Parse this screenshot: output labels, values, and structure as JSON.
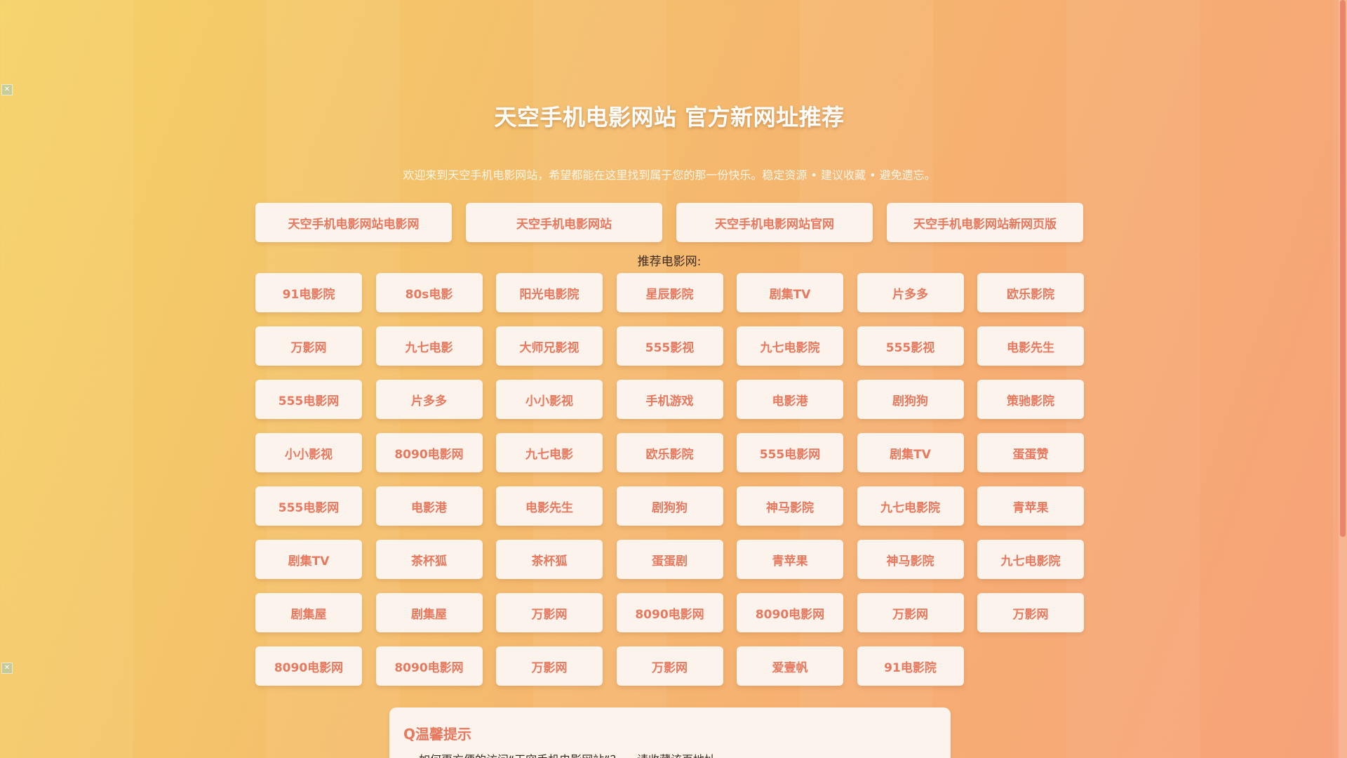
{
  "page": {
    "title": "天空手机电影网站 官方新网址推荐",
    "subtitle": "欢迎来到天空手机电影网站，希望都能在这里找到属于您的那一份快乐。稳定资源 • 建议收藏 • 避免遗忘。"
  },
  "top_links": [
    "天空手机电影网站电影网",
    "天空手机电影网站",
    "天空手机电影网站官网",
    "天空手机电影网站新网页版"
  ],
  "recommend_label": "推荐电影网:",
  "sites": [
    "91电影院",
    "80s电影",
    "阳光电影院",
    "星辰影院",
    "剧集TV",
    "片多多",
    "欧乐影院",
    "万影网",
    "九七电影",
    "大师兄影视",
    "555影视",
    "九七电影院",
    "555影视",
    "电影先生",
    "555电影网",
    "片多多",
    "小小影视",
    "手机游戏",
    "电影港",
    "剧狗狗",
    "策驰影院",
    "小小影视",
    "8090电影网",
    "九七电影",
    "欧乐影院",
    "555电影网",
    "剧集TV",
    "蛋蛋赞",
    "555电影网",
    "电影港",
    "电影先生",
    "剧狗狗",
    "神马影院",
    "九七电影院",
    "青苹果",
    "剧集TV",
    "茶杯狐",
    "茶杯狐",
    "蛋蛋剧",
    "青苹果",
    "神马影院",
    "九七电影院",
    "剧集屋",
    "剧集屋",
    "万影网",
    "8090电影网",
    "8090电影网",
    "万影网",
    "万影网",
    "8090电影网",
    "8090电影网",
    "万影网",
    "万影网",
    "爱壹帆",
    "91电影院"
  ],
  "tips": {
    "title": "Q温馨提示",
    "items": [
      "如何更方便的访问“天空手机电影网站”？ ---请收藏该页地址"
    ]
  },
  "colors": {
    "accent": "#e8785e",
    "card_bg": "#fcf3ec",
    "bg_start": "#f5d266",
    "bg_end": "#f7a27a"
  }
}
